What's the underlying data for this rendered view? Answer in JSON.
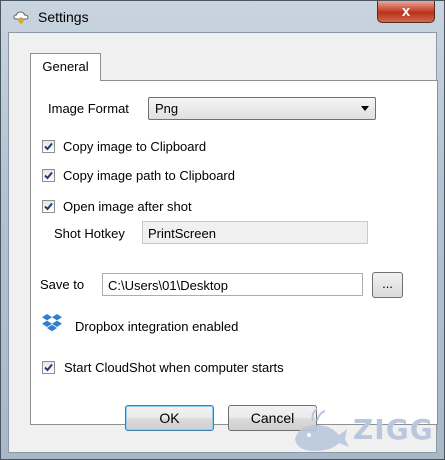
{
  "window": {
    "title": "Settings",
    "close_label": "x"
  },
  "tabs": [
    {
      "label": "General"
    }
  ],
  "general": {
    "image_format": {
      "label": "Image Format",
      "value": "Png"
    },
    "copy_image": {
      "label": "Copy image to Clipboard",
      "checked": true
    },
    "copy_path": {
      "label": "Copy image path to Clipboard",
      "checked": true
    },
    "open_after": {
      "label": "Open image after shot",
      "checked": true
    },
    "hotkey": {
      "label": "Shot Hotkey",
      "value": "PrintScreen"
    },
    "save_to": {
      "label": "Save to",
      "value": "C:\\Users\\01\\Desktop",
      "browse_label": "..."
    },
    "dropbox": {
      "label": "Dropbox integration enabled",
      "icon": "dropbox-icon"
    },
    "start_with_computer": {
      "label": "Start CloudShot when computer starts",
      "checked": true
    }
  },
  "buttons": {
    "ok": "OK",
    "cancel": "Cancel"
  },
  "watermark": {
    "text": "ZIGG"
  },
  "colors": {
    "accent": "#1f5fa8",
    "close_red": "#c7462f",
    "dropbox_blue": "#2f7fd0",
    "watermark": "#b9c7dd"
  }
}
